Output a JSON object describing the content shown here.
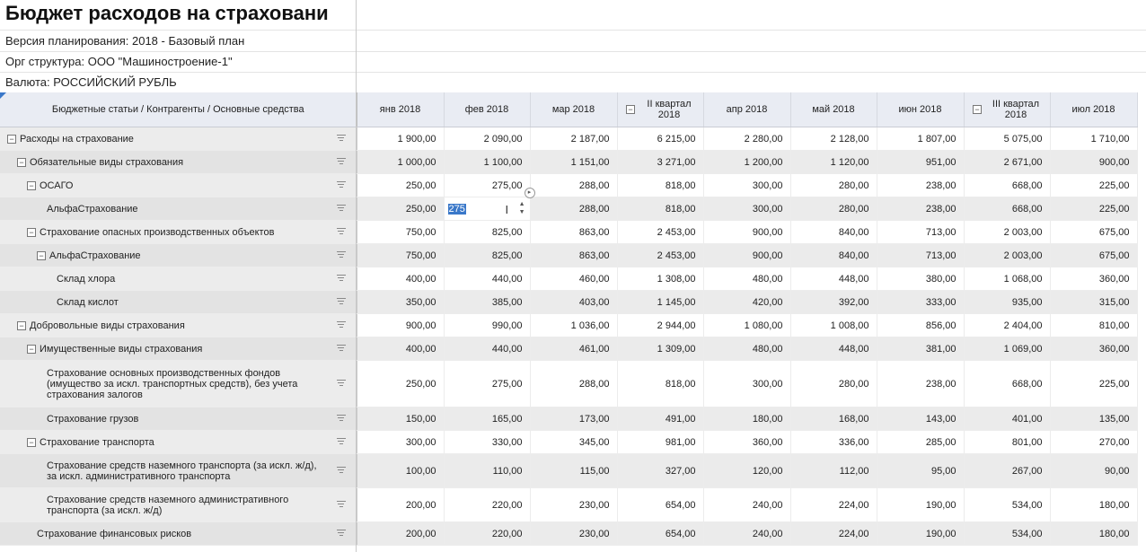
{
  "title": "Бюджет расходов на страховани",
  "meta": {
    "version": "Версия планирования: 2018 - Базовый план",
    "org": "Орг структура: ООО \"Машиностроение-1\"",
    "currency": "Валюта: РОССИЙСКИЙ РУБЛЬ"
  },
  "grid": {
    "first_header": "Бюджетные статьи / Контрагенты / Основные средства",
    "columns": [
      {
        "label": "янв 2018",
        "quarter": false
      },
      {
        "label": "фев 2018",
        "quarter": false
      },
      {
        "label": "мар 2018",
        "quarter": false
      },
      {
        "label": "II квартал 2018",
        "quarter": true
      },
      {
        "label": "апр 2018",
        "quarter": false
      },
      {
        "label": "май 2018",
        "quarter": false
      },
      {
        "label": "июн 2018",
        "quarter": false
      },
      {
        "label": "III квартал 2018",
        "quarter": true
      },
      {
        "label": "июл 2018",
        "quarter": false
      }
    ],
    "edit": {
      "row": 3,
      "col": 1,
      "value": "275"
    },
    "rows": [
      {
        "label": "Расходы на страхование",
        "level": 0,
        "toggle": "minus",
        "values": [
          "1 900,00",
          "2 090,00",
          "2 187,00",
          "6 215,00",
          "2 280,00",
          "2 128,00",
          "1 807,00",
          "5 075,00",
          "1 710,00"
        ]
      },
      {
        "label": "Обязательные виды страхования",
        "level": 1,
        "toggle": "minus",
        "values": [
          "1 000,00",
          "1 100,00",
          "1 151,00",
          "3 271,00",
          "1 200,00",
          "1 120,00",
          "951,00",
          "2 671,00",
          "900,00"
        ]
      },
      {
        "label": "ОСАГО",
        "level": 2,
        "toggle": "minus",
        "values": [
          "250,00",
          "275,00",
          "288,00",
          "818,00",
          "300,00",
          "280,00",
          "238,00",
          "668,00",
          "225,00"
        ]
      },
      {
        "label": "АльфаСтрахование",
        "level": 4,
        "toggle": "",
        "values": [
          "250,00",
          "275",
          "288,00",
          "818,00",
          "300,00",
          "280,00",
          "238,00",
          "668,00",
          "225,00"
        ]
      },
      {
        "label": "Страхование опасных производственных объектов",
        "level": 2,
        "toggle": "minus",
        "values": [
          "750,00",
          "825,00",
          "863,00",
          "2 453,00",
          "900,00",
          "840,00",
          "713,00",
          "2 003,00",
          "675,00"
        ]
      },
      {
        "label": "АльфаСтрахование",
        "level": 3,
        "toggle": "minus",
        "values": [
          "750,00",
          "825,00",
          "863,00",
          "2 453,00",
          "900,00",
          "840,00",
          "713,00",
          "2 003,00",
          "675,00"
        ]
      },
      {
        "label": "Склад хлора",
        "level": 5,
        "toggle": "",
        "values": [
          "400,00",
          "440,00",
          "460,00",
          "1 308,00",
          "480,00",
          "448,00",
          "380,00",
          "1 068,00",
          "360,00"
        ]
      },
      {
        "label": "Склад кислот",
        "level": 5,
        "toggle": "",
        "values": [
          "350,00",
          "385,00",
          "403,00",
          "1 145,00",
          "420,00",
          "392,00",
          "333,00",
          "935,00",
          "315,00"
        ]
      },
      {
        "label": "Добровольные виды страхования",
        "level": 1,
        "toggle": "minus",
        "values": [
          "900,00",
          "990,00",
          "1 036,00",
          "2 944,00",
          "1 080,00",
          "1 008,00",
          "856,00",
          "2 404,00",
          "810,00"
        ]
      },
      {
        "label": "Имущественные виды страхования",
        "level": 2,
        "toggle": "minus",
        "values": [
          "400,00",
          "440,00",
          "461,00",
          "1 309,00",
          "480,00",
          "448,00",
          "381,00",
          "1 069,00",
          "360,00"
        ]
      },
      {
        "label": "Страхование основных производственных фондов (имущество за искл. транспортных средств), без учета страхования залогов",
        "level": 4,
        "toggle": "",
        "values": [
          "250,00",
          "275,00",
          "288,00",
          "818,00",
          "300,00",
          "280,00",
          "238,00",
          "668,00",
          "225,00"
        ]
      },
      {
        "label": "Страхование грузов",
        "level": 4,
        "toggle": "",
        "values": [
          "150,00",
          "165,00",
          "173,00",
          "491,00",
          "180,00",
          "168,00",
          "143,00",
          "401,00",
          "135,00"
        ]
      },
      {
        "label": "Страхование транспорта",
        "level": 2,
        "toggle": "minus",
        "values": [
          "300,00",
          "330,00",
          "345,00",
          "981,00",
          "360,00",
          "336,00",
          "285,00",
          "801,00",
          "270,00"
        ]
      },
      {
        "label": "Страхование средств наземного транспорта (за искл. ж/д), за искл. административного транспорта",
        "level": 4,
        "toggle": "",
        "values": [
          "100,00",
          "110,00",
          "115,00",
          "327,00",
          "120,00",
          "112,00",
          "95,00",
          "267,00",
          "90,00"
        ]
      },
      {
        "label": "Страхование средств наземного административного транспорта (за искл. ж/д)",
        "level": 4,
        "toggle": "",
        "values": [
          "200,00",
          "220,00",
          "230,00",
          "654,00",
          "240,00",
          "224,00",
          "190,00",
          "534,00",
          "180,00"
        ]
      },
      {
        "label": "Страхование финансовых рисков",
        "level": 3,
        "toggle": "",
        "values": [
          "200,00",
          "220,00",
          "230,00",
          "654,00",
          "240,00",
          "224,00",
          "190,00",
          "534,00",
          "180,00"
        ]
      }
    ]
  }
}
